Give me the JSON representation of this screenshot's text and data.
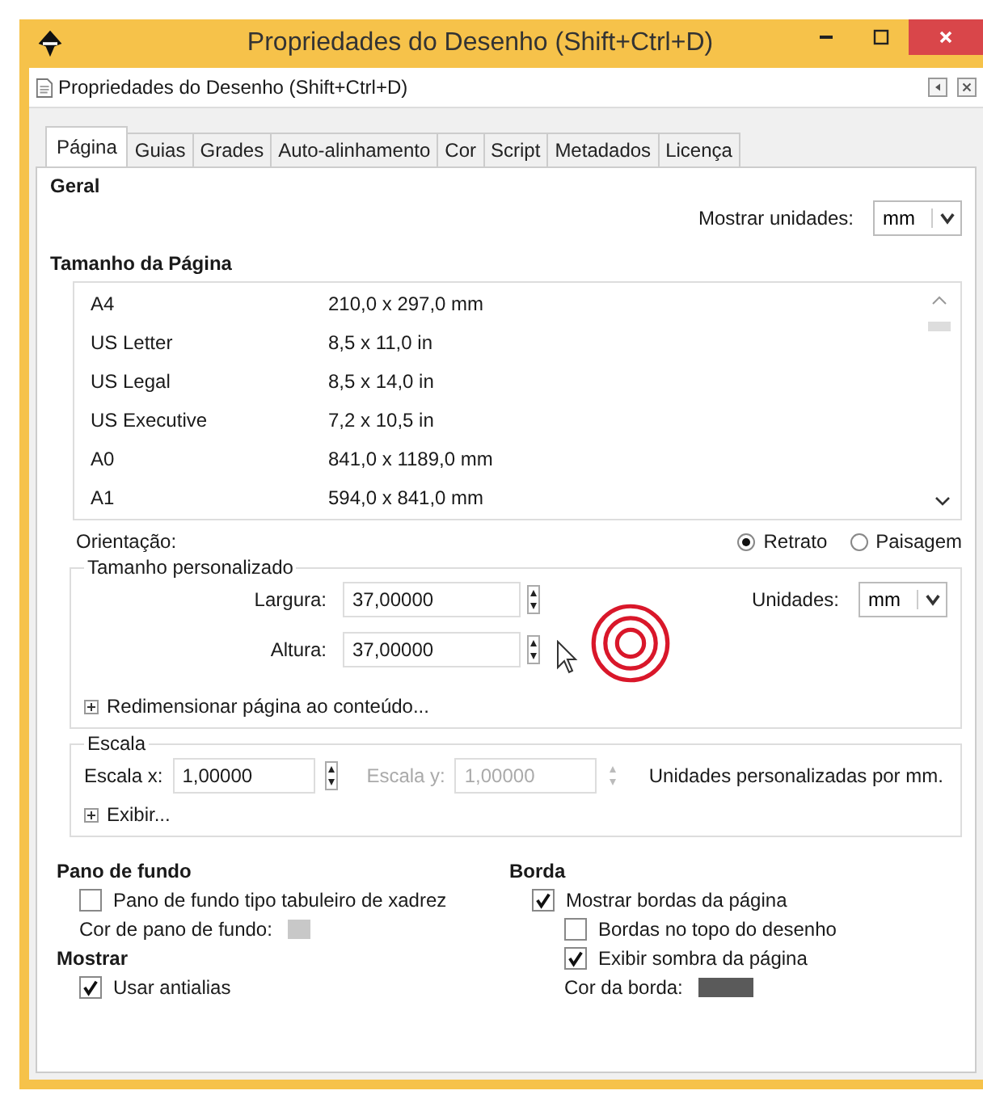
{
  "window": {
    "title": "Propriedades do Desenho (Shift+Ctrl+D)"
  },
  "panel": {
    "title": "Propriedades do Desenho (Shift+Ctrl+D)"
  },
  "tabs": [
    {
      "label": "Página",
      "selected": true
    },
    {
      "label": "Guias",
      "selected": false
    },
    {
      "label": "Grades",
      "selected": false
    },
    {
      "label": "Auto-alinhamento",
      "selected": false
    },
    {
      "label": "Cor",
      "selected": false
    },
    {
      "label": "Script",
      "selected": false
    },
    {
      "label": "Metadados",
      "selected": false
    },
    {
      "label": "Licença",
      "selected": false
    }
  ],
  "general": {
    "heading": "Geral",
    "units_label": "Mostrar unidades:",
    "units_value": "mm"
  },
  "page_size": {
    "heading": "Tamanho da Página",
    "rows": [
      {
        "name": "A4",
        "size": "210,0 x 297,0 mm"
      },
      {
        "name": "US Letter",
        "size": "8,5 x 11,0 in"
      },
      {
        "name": "US Legal",
        "size": "8,5 x 14,0 in"
      },
      {
        "name": "US Executive",
        "size": "7,2 x 10,5 in"
      },
      {
        "name": "A0",
        "size": "841,0 x 1189,0 mm"
      },
      {
        "name": "A1",
        "size": "594,0 x 841,0 mm"
      }
    ],
    "orientation_label": "Orientação:",
    "orientations": [
      {
        "label": "Retrato",
        "selected": true
      },
      {
        "label": "Paisagem",
        "selected": false
      }
    ]
  },
  "custom_size": {
    "legend": "Tamanho personalizado",
    "width_label": "Largura:",
    "width_value": "37,00000",
    "height_label": "Altura:",
    "height_value": "37,00000",
    "units_label": "Unidades:",
    "units_value": "mm",
    "resize_label": "Redimensionar página ao conteúdo..."
  },
  "scale": {
    "legend": "Escala",
    "x_label": "Escala x:",
    "x_value": "1,00000",
    "y_label": "Escala y:",
    "y_value": "1,00000",
    "y_disabled": true,
    "note": "Unidades personalizadas por mm.",
    "show_label": "Exibir..."
  },
  "background": {
    "heading": "Pano de fundo",
    "checkerboard": {
      "label": "Pano de fundo tipo tabuleiro de xadrez",
      "checked": false
    },
    "color_label": "Cor de pano de fundo:",
    "color": "#c8c8c8"
  },
  "display": {
    "heading": "Mostrar",
    "antialias": {
      "label": "Usar antialias",
      "checked": true
    }
  },
  "border": {
    "heading": "Borda",
    "options": [
      {
        "label": "Mostrar bordas da página",
        "checked": true,
        "indent": false
      },
      {
        "label": "Bordas no topo do desenho",
        "checked": false,
        "indent": true
      },
      {
        "label": "Exibir sombra da página",
        "checked": true,
        "indent": true
      }
    ],
    "color_label": "Cor da borda:",
    "color": "#5a5a5a"
  }
}
